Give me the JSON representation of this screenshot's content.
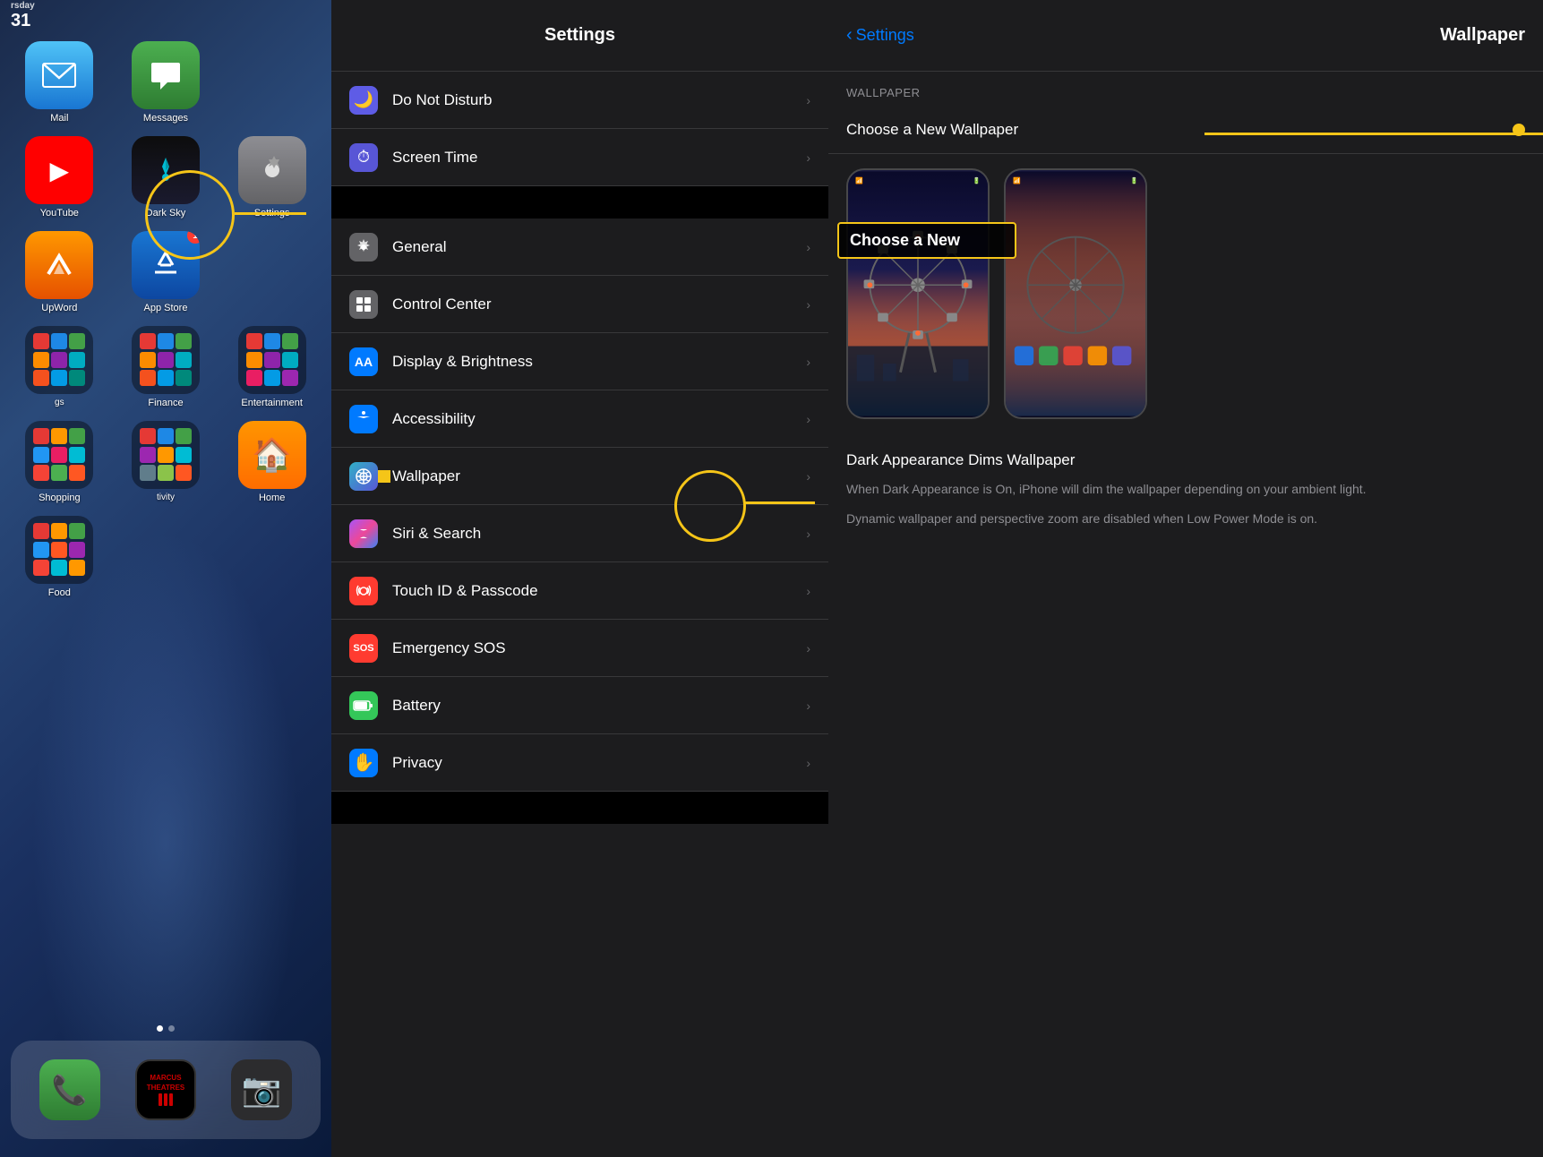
{
  "homeScreen": {
    "statusBar": {
      "day": "rsday",
      "date": "31"
    },
    "apps": [
      {
        "id": "mail",
        "label": "Mail",
        "icon": "✉️",
        "iconClass": "icon-mail",
        "badge": null
      },
      {
        "id": "messages",
        "label": "Messages",
        "icon": "💬",
        "iconClass": "icon-messages",
        "badge": null
      },
      {
        "id": "youtube",
        "label": "YouTube",
        "icon": "▶",
        "iconClass": "icon-youtube",
        "badge": null
      },
      {
        "id": "darksky",
        "label": "Dark Sky",
        "icon": "⚡",
        "iconClass": "icon-darksky",
        "badge": null
      },
      {
        "id": "settings",
        "label": "Settings",
        "icon": "⚙️",
        "iconClass": "icon-settings",
        "badge": null
      },
      {
        "id": "upword",
        "label": "UpWord",
        "icon": "✓",
        "iconClass": "icon-upword",
        "badge": null
      },
      {
        "id": "appstore",
        "label": "App Store",
        "icon": "A",
        "iconClass": "icon-appstore",
        "badge": "1"
      },
      {
        "id": "games",
        "label": "Games",
        "icon": "",
        "iconClass": "icon-games-folder",
        "badge": null
      },
      {
        "id": "finance",
        "label": "Finance",
        "icon": "",
        "iconClass": "icon-finance",
        "badge": null
      },
      {
        "id": "entertainment",
        "label": "Entertainment",
        "icon": "",
        "iconClass": "icon-entertainment",
        "badge": null
      },
      {
        "id": "shopping",
        "label": "Shopping",
        "icon": "",
        "iconClass": "icon-shopping",
        "badge": null
      },
      {
        "id": "activity",
        "label": "Activity",
        "icon": "",
        "iconClass": "icon-activity",
        "badge": null
      },
      {
        "id": "home",
        "label": "Home",
        "icon": "🏠",
        "iconClass": "icon-home",
        "badge": null
      },
      {
        "id": "food",
        "label": "Food",
        "icon": "",
        "iconClass": "icon-food",
        "badge": null
      }
    ],
    "dock": [
      {
        "id": "phone",
        "label": "Phone",
        "icon": "📞",
        "iconClass": "icon-messages"
      },
      {
        "id": "theatre",
        "label": "Marcus Theatres",
        "icon": "🎬",
        "iconClass": "icon-youtube"
      },
      {
        "id": "camera",
        "label": "Camera",
        "icon": "📷",
        "iconClass": "icon-darksky"
      }
    ]
  },
  "settings": {
    "title": "Settings",
    "rows": [
      {
        "id": "do-not-disturb",
        "label": "Do Not Disturb",
        "iconClass": "icon-bg-purple",
        "icon": "🌙"
      },
      {
        "id": "screen-time",
        "label": "Screen Time",
        "iconClass": "icon-bg-indigo",
        "icon": "⏱"
      },
      {
        "id": "general",
        "label": "General",
        "iconClass": "icon-bg-gray",
        "icon": "⚙️"
      },
      {
        "id": "control-center",
        "label": "Control Center",
        "iconClass": "icon-bg-toggle",
        "icon": "⊟"
      },
      {
        "id": "display-brightness",
        "label": "Display & Brightness",
        "iconClass": "icon-bg-blue",
        "icon": "AA"
      },
      {
        "id": "accessibility",
        "label": "Accessibility",
        "iconClass": "icon-bg-blue",
        "icon": "♿"
      },
      {
        "id": "wallpaper",
        "label": "Wallpaper",
        "iconClass": "icon-bg-wallpaper",
        "icon": "❋"
      },
      {
        "id": "siri-search",
        "label": "Siri & Search",
        "iconClass": "icon-bg-pink",
        "icon": "✦"
      },
      {
        "id": "touch-id",
        "label": "Touch ID & Passcode",
        "iconClass": "icon-bg-red",
        "icon": "◉"
      },
      {
        "id": "emergency-sos",
        "label": "Emergency SOS",
        "iconClass": "icon-bg-red",
        "icon": "SOS"
      },
      {
        "id": "battery",
        "label": "Battery",
        "iconClass": "icon-bg-green",
        "icon": "▬"
      },
      {
        "id": "privacy",
        "label": "Privacy",
        "iconClass": "icon-bg-blue",
        "icon": "✋"
      }
    ]
  },
  "wallpaper": {
    "backLabel": "Settings",
    "title": "Wallpaper",
    "sectionHeader": "WALLPAPER",
    "chooseLabel": "Choose a New Wallpaper",
    "dimTitle": "Dark Appearance Dims Wallpaper",
    "dimDesc1": "When Dark Appearance is On, iPhone will dim the wallpaper depending on your ambient light.",
    "dimDesc2": "Dynamic wallpaper and perspective zoom are disabled when Low Power Mode is on.",
    "previewAnnotationText": "Choose a New"
  },
  "annotations": {
    "settingsCircleLabel": "Settings",
    "wallpaperRowDot": true,
    "wallpaperChooseDot": true,
    "wallpaperPreviewBox": true
  }
}
